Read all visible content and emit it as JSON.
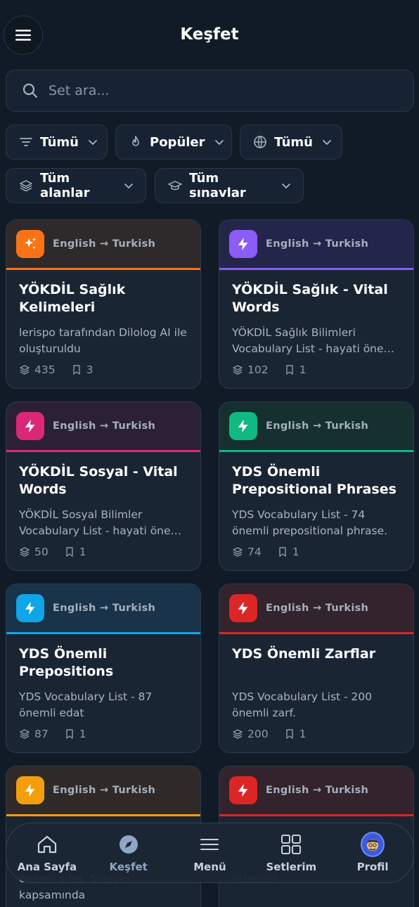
{
  "header": {
    "title": "Keşfet",
    "menu_icon": "hamburger-icon"
  },
  "search": {
    "placeholder": "Set ara...",
    "value": ""
  },
  "filters": [
    {
      "label": "Tümü",
      "icon": "filter-icon"
    },
    {
      "label": "Popüler",
      "icon": "flame-icon"
    },
    {
      "label": "Tümü",
      "icon": "globe-icon"
    },
    {
      "label": "Tüm alanlar",
      "icon": "layers-icon"
    },
    {
      "label": "Tüm sınavlar",
      "icon": "graduation-cap-icon"
    }
  ],
  "cards": [
    {
      "lang": "English → Turkish",
      "title": "YÖKDİL Sağlık Kelimeleri",
      "desc": "lerispo tarafından Dilolog AI ile oluşturuldu",
      "words": "435",
      "saves": "3",
      "icon": "sparkles-icon",
      "accent": "#f97316",
      "top_bg": "#2e2a2b"
    },
    {
      "lang": "English → Turkish",
      "title": "YÖKDİL Sağlık - Vital Words",
      "desc": "YÖKDİL Sağlık Bilimleri Vocabulary List - hayati önemli kelimeler",
      "words": "102",
      "saves": "1",
      "icon": "bolt-icon",
      "accent": "#8b5cf6",
      "top_bg": "#24254a"
    },
    {
      "lang": "English → Turkish",
      "title": "YÖKDİL Sosyal - Vital Words",
      "desc": "YÖKDİL Sosyal Bilimler Vocabulary List - hayati önemli kelimeler",
      "words": "50",
      "saves": "1",
      "icon": "bolt-icon",
      "accent": "#db2777",
      "top_bg": "#2c2037"
    },
    {
      "lang": "English → Turkish",
      "title": "YDS Önemli Prepositional Phrases",
      "desc": "YDS Vocabulary List - 74 önemli prepositional phrase.",
      "words": "74",
      "saves": "1",
      "icon": "bolt-icon",
      "accent": "#10b981",
      "top_bg": "#15302f"
    },
    {
      "lang": "English → Turkish",
      "title": "YDS Önemli Prepositions",
      "desc": "YDS Vocabulary List - 87 önemli edat",
      "words": "87",
      "saves": "1",
      "icon": "bolt-icon",
      "accent": "#0ea5e9",
      "top_bg": "#18334a"
    },
    {
      "lang": "English → Turkish",
      "title": "YDS Önemli Zarflar",
      "desc": "YDS Vocabulary List - 200 önemli zarf.",
      "words": "200",
      "saves": "1",
      "icon": "bolt-icon",
      "accent": "#dc2626",
      "top_bg": "#33232c"
    },
    {
      "lang": "English → Turkish",
      "title": "",
      "desc": "önemli sıfat. Sınavın kapsamında",
      "words": "",
      "saves": "",
      "icon": "bolt-icon",
      "accent": "#f59e0b",
      "top_bg": "#2f2a28"
    },
    {
      "lang": "English → Turkish",
      "title": "",
      "desc": "listesidir.",
      "words": "",
      "saves": "",
      "icon": "bolt-icon",
      "accent": "#dc2626",
      "top_bg": "#33232c"
    }
  ],
  "tabbar": [
    {
      "label": "Ana Sayfa",
      "icon": "home-icon"
    },
    {
      "label": "Keşfet",
      "icon": "compass-icon"
    },
    {
      "label": "Menü",
      "icon": "menu-lines-icon"
    },
    {
      "label": "Setlerim",
      "icon": "grid-icon"
    },
    {
      "label": "Profil",
      "icon": "avatar"
    }
  ],
  "colors": {
    "background": "#111b27",
    "card": "#1a2534",
    "active_tab": "#8fa6c6"
  }
}
